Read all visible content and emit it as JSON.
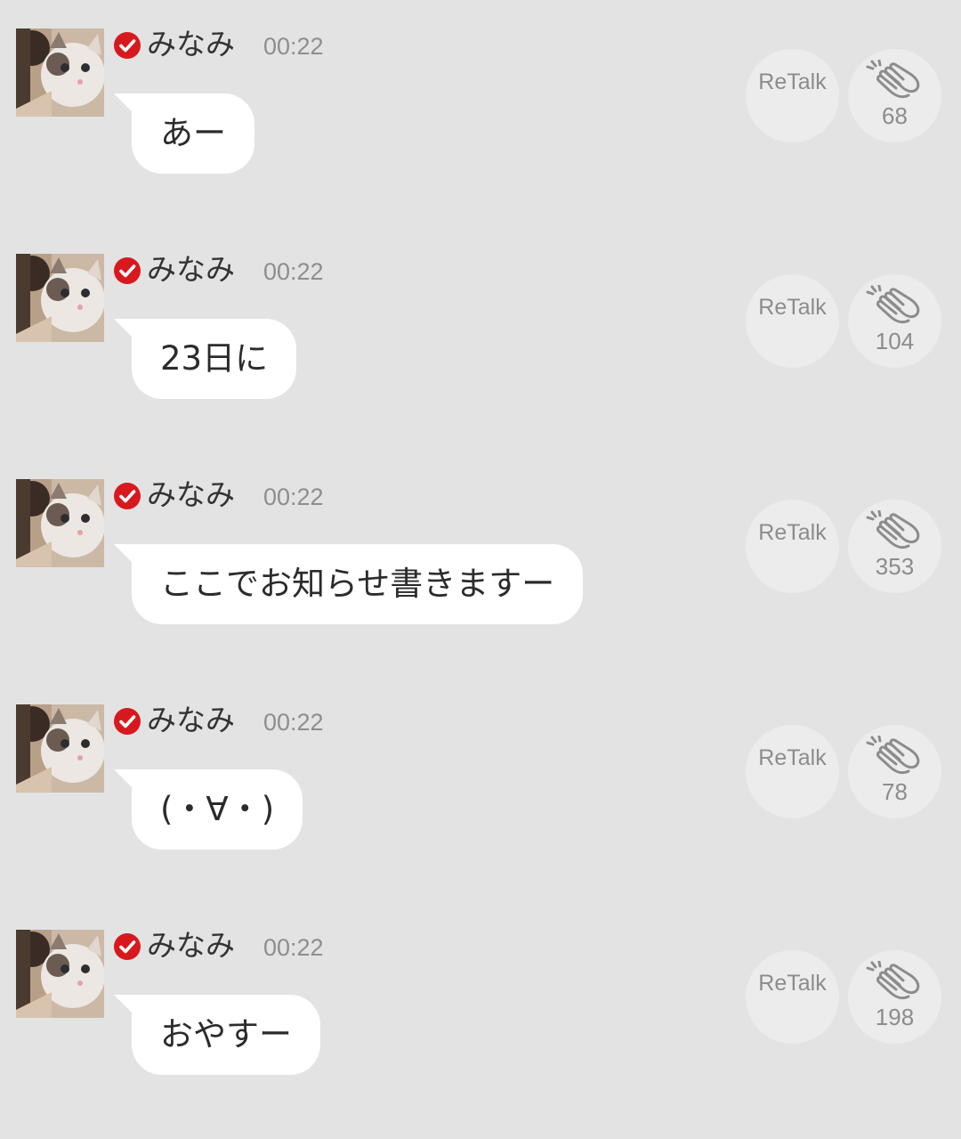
{
  "posts": [
    {
      "name": "みなみ",
      "time": "00:22",
      "message": "あー",
      "retalk_label": "ReTalk",
      "clap_count": "68"
    },
    {
      "name": "みなみ",
      "time": "00:22",
      "message": "23日に",
      "retalk_label": "ReTalk",
      "clap_count": "104"
    },
    {
      "name": "みなみ",
      "time": "00:22",
      "message": "ここでお知らせ書きますー",
      "retalk_label": "ReTalk",
      "clap_count": "353"
    },
    {
      "name": "みなみ",
      "time": "00:22",
      "message": "(・∀・)",
      "retalk_label": "ReTalk",
      "clap_count": "78"
    },
    {
      "name": "みなみ",
      "time": "00:22",
      "message": "おやすー",
      "retalk_label": "ReTalk",
      "clap_count": "198"
    }
  ],
  "icons": {
    "verified": "verified-check-icon",
    "clap": "clapping-hands-icon",
    "avatar": "profile-photo-cat"
  },
  "colors": {
    "background": "#e3e3e3",
    "bubble": "#ffffff",
    "verified_badge": "#d7191f",
    "action_circle": "#ececec",
    "muted_text": "#8c8c8c"
  }
}
